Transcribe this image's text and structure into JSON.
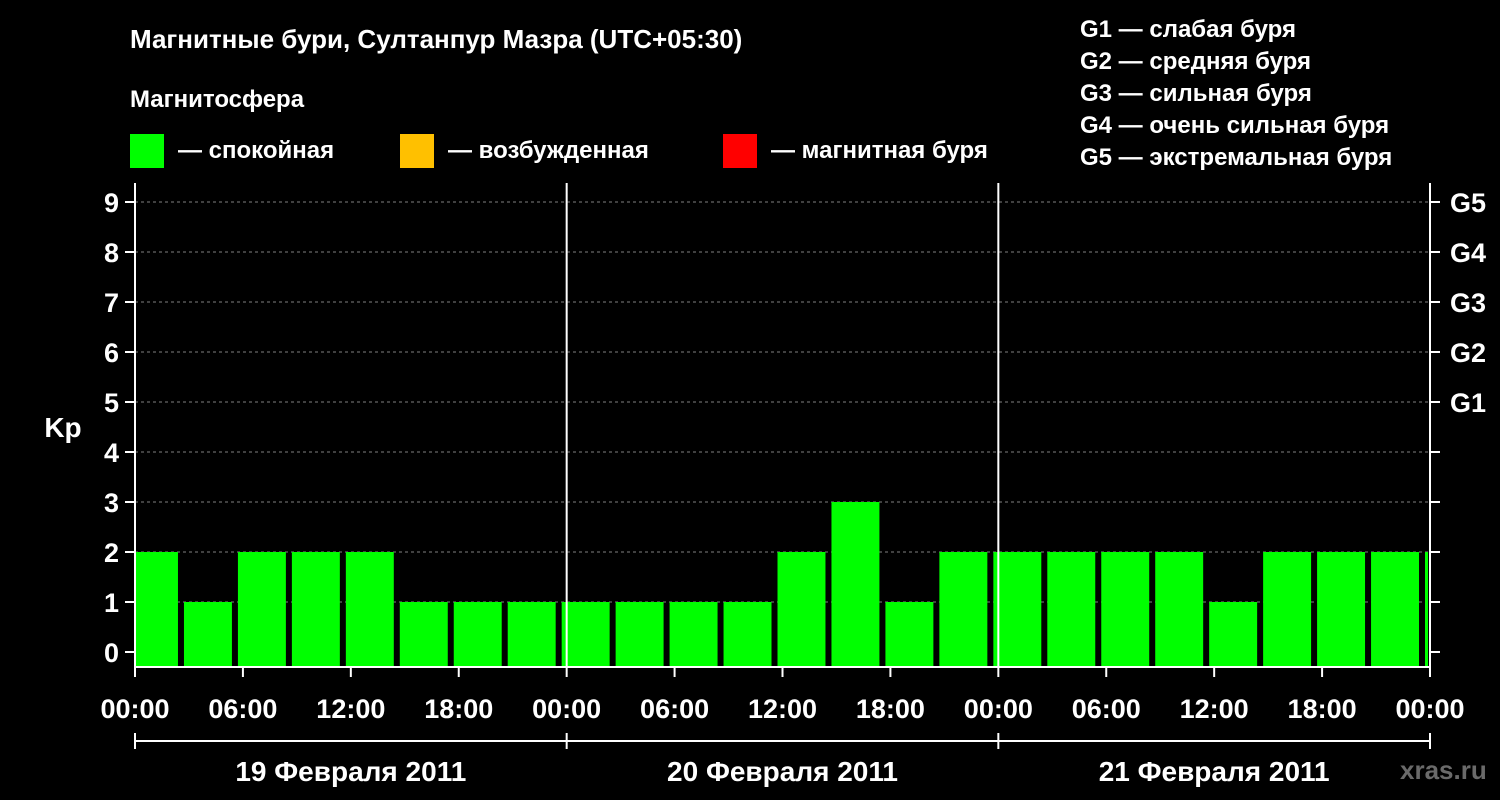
{
  "title": "Магнитные бури, Султанпур Мазра (UTC+05:30)",
  "legend": {
    "title": "Магнитосфера",
    "items": [
      {
        "label": "— спокойная",
        "color": "#00ff00"
      },
      {
        "label": "— возбужденная",
        "color": "#ffc000"
      },
      {
        "label": "— магнитная буря",
        "color": "#ff0000"
      }
    ]
  },
  "g_scale": [
    "G1 — слабая буря",
    "G2 — средняя буря",
    "G3 — сильная буря",
    "G4 — очень сильная буря",
    "G5 — экстремальная буря"
  ],
  "watermark": "xras.ru",
  "chart_data": {
    "type": "bar",
    "ylabel": "Kp",
    "ylim": [
      0,
      9
    ],
    "yticks": [
      "0",
      "1",
      "2",
      "3",
      "4",
      "5",
      "6",
      "7",
      "8",
      "9"
    ],
    "right_labels": [
      {
        "kp": 5,
        "label": "G1"
      },
      {
        "kp": 6,
        "label": "G2"
      },
      {
        "kp": 7,
        "label": "G3"
      },
      {
        "kp": 8,
        "label": "G4"
      },
      {
        "kp": 9,
        "label": "G5"
      }
    ],
    "grid": true,
    "xticks": [
      "00:00",
      "06:00",
      "12:00",
      "18:00",
      "00:00",
      "06:00",
      "12:00",
      "18:00",
      "00:00",
      "06:00",
      "12:00",
      "18:00",
      "00:00"
    ],
    "days": [
      "19 Февраля 2011",
      "20 Февраля 2011",
      "21 Февраля 2011"
    ],
    "bar_start_hours": [
      0,
      2.5,
      5.5,
      8.5,
      11.5,
      14.5,
      17.5,
      20.5,
      23.5,
      26.5,
      29.5,
      32.5,
      35.5,
      38.5,
      41.5,
      44.5,
      47.5,
      50.5,
      53.5,
      56.5,
      59.5,
      62.5,
      65.5,
      68.5,
      71.5
    ],
    "values": [
      2,
      1,
      2,
      2,
      2,
      1,
      1,
      1,
      1,
      1,
      1,
      1,
      2,
      3,
      1,
      2,
      2,
      2,
      2,
      2,
      1,
      2,
      2,
      2,
      2
    ]
  }
}
